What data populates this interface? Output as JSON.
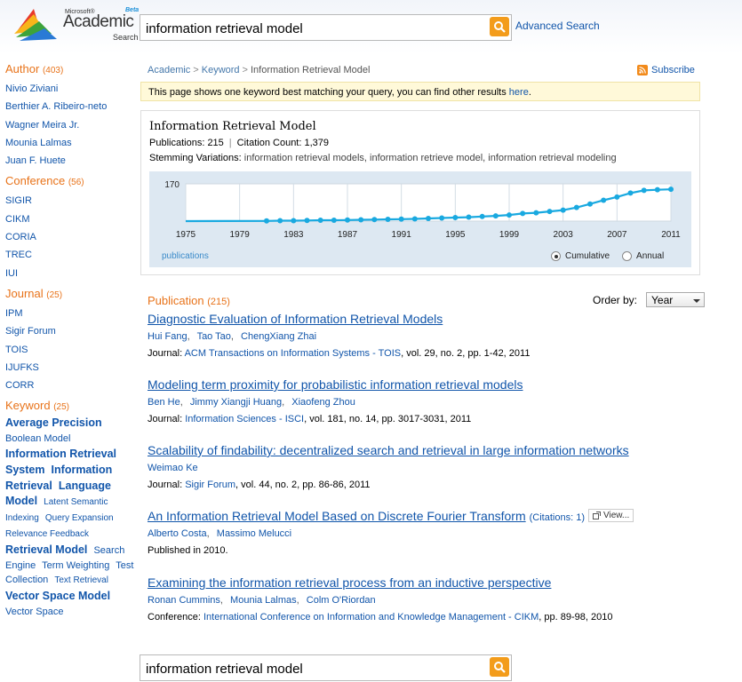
{
  "header": {
    "logo": {
      "ms": "Microsoft®",
      "main": "Academic",
      "sub": "Search",
      "beta": "Beta"
    },
    "search_value": "information retrieval model",
    "advanced_search": "Advanced Search"
  },
  "colors": {
    "accent_orange": "#e8731a",
    "link_blue": "#1155aa",
    "search_button": "#f39c1b",
    "chart_line": "#19a9e0",
    "chart_bg": "#dde8f2"
  },
  "sidebar": {
    "author": {
      "title": "Author",
      "count": "(403)",
      "items": [
        "Nivio Ziviani",
        "Berthier A. Ribeiro-neto",
        "Wagner Meira Jr.",
        "Mounia Lalmas",
        "Juan F. Huete"
      ]
    },
    "conference": {
      "title": "Conference",
      "count": "(56)",
      "items": [
        "SIGIR",
        "CIKM",
        "CORIA",
        "TREC",
        "IUI"
      ]
    },
    "journal": {
      "title": "Journal",
      "count": "(25)",
      "items": [
        "IPM",
        "Sigir Forum",
        "TOIS",
        "IJUFKS",
        "CORR"
      ]
    },
    "keyword": {
      "title": "Keyword",
      "count": "(25)",
      "items": [
        "Average Precision",
        "Boolean Model",
        "Information Retrieval System",
        "Information Retrieval",
        "Language Model",
        "Latent Semantic Indexing",
        "Query Expansion",
        "Relevance Feedback",
        "Retrieval Model",
        "Search Engine",
        "Term Weighting",
        "Test Collection",
        "Text Retrieval",
        "Vector Space Model",
        "Vector Space"
      ]
    }
  },
  "breadcrumb": {
    "items": [
      "Academic",
      "Keyword",
      "Information Retrieval Model"
    ],
    "sep": ">"
  },
  "subscribe": "Subscribe",
  "notice": {
    "text": "This page shows one keyword best matching your query, you can find other results ",
    "link": "here",
    "end": "."
  },
  "info": {
    "title": "Information Retrieval Model",
    "publications_label": "Publications:",
    "publications": "215",
    "citations_label": "Citation Count:",
    "citations": "1,379",
    "stem_label": "Stemming Variations:",
    "stem_values": "information retrieval models, information retrieve model, information retrieval modeling",
    "legend": "publications",
    "cumulative": "Cumulative",
    "annual": "Annual"
  },
  "chart_data": {
    "type": "line",
    "ymax_label": "170",
    "ylim": [
      0,
      170
    ],
    "xlim": [
      1975,
      2011
    ],
    "x_ticks": [
      "1975",
      "1979",
      "1983",
      "1987",
      "1991",
      "1995",
      "1999",
      "2003",
      "2007",
      "2011"
    ],
    "series": [
      {
        "name": "publications",
        "x": [
          1981,
          1982,
          1983,
          1984,
          1985,
          1986,
          1987,
          1988,
          1989,
          1990,
          1991,
          1992,
          1993,
          1994,
          1995,
          1996,
          1997,
          1998,
          1999,
          2000,
          2001,
          2002,
          2003,
          2004,
          2005,
          2006,
          2007,
          2008,
          2009,
          2010,
          2011
        ],
        "y": [
          1,
          2,
          2,
          3,
          4,
          4,
          5,
          6,
          7,
          8,
          9,
          10,
          12,
          14,
          16,
          18,
          21,
          24,
          28,
          35,
          38,
          44,
          50,
          62,
          78,
          95,
          110,
          128,
          140,
          143,
          145
        ]
      }
    ],
    "grid": true,
    "mode": "cumulative"
  },
  "publications": {
    "title": "Publication",
    "count": "(215)",
    "order_label": "Order by:",
    "order_value": "Year",
    "items": [
      {
        "title": "Diagnostic Evaluation of Information Retrieval Models",
        "authors": [
          "Hui Fang",
          "Tao Tao",
          "ChengXiang Zhai"
        ],
        "venue_label": "Journal:",
        "venue": "ACM Transactions on Information Systems - TOIS",
        "details": ", vol. 29, no. 2, pp. 1-42, 2011"
      },
      {
        "title": "Modeling term proximity for probabilistic information retrieval models",
        "authors": [
          "Ben He",
          "Jimmy Xiangji Huang",
          "Xiaofeng Zhou"
        ],
        "venue_label": "Journal:",
        "venue": "Information Sciences - ISCI",
        "details": ", vol. 181, no. 14, pp. 3017-3031, 2011"
      },
      {
        "title": "Scalability of findability: decentralized search and retrieval in large information networks",
        "authors": [
          "Weimao Ke"
        ],
        "venue_label": "Journal:",
        "venue": "Sigir Forum",
        "details": ", vol. 44, no. 2, pp. 86-86, 2011"
      },
      {
        "title": "An Information Retrieval Model Based on Discrete Fourier Transform",
        "citations": "(Citations: 1)",
        "view": "View...",
        "authors": [
          "Alberto Costa",
          "Massimo Melucci"
        ],
        "published": "Published in 2010."
      },
      {
        "title": "Examining the information retrieval process from an inductive perspective",
        "authors": [
          "Ronan Cummins",
          "Mounia Lalmas",
          "Colm O'Riordan"
        ],
        "venue_label": "Conference:",
        "venue": "International Conference on Information and Knowledge Management - CIKM",
        "details": ", pp. 89-98, 2010"
      }
    ]
  },
  "footer_search_value": "information retrieval model"
}
